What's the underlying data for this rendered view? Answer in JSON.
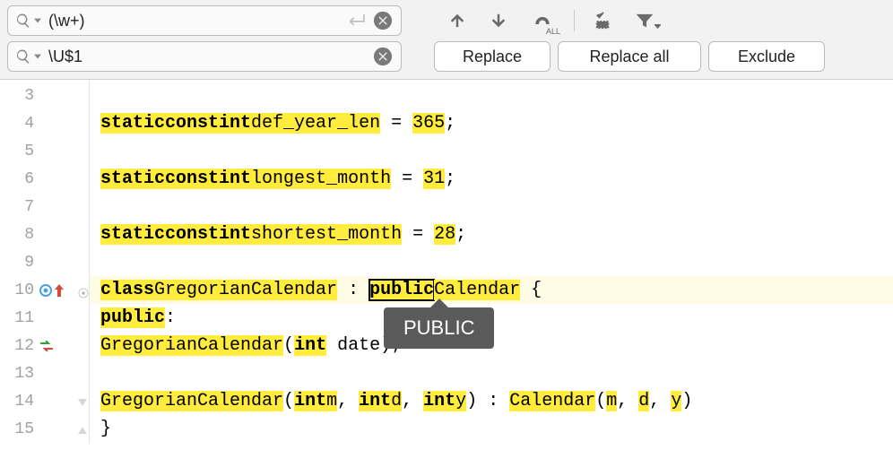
{
  "search": {
    "find_value": "(\\w+)",
    "replace_value": "\\U$1"
  },
  "buttons": {
    "replace": "Replace",
    "replace_all": "Replace all",
    "exclude": "Exclude"
  },
  "tooltip": "PUBLIC",
  "lines": {
    "l3": "3",
    "l4": "4",
    "l5": "5",
    "l6": "6",
    "l7": "7",
    "l8": "8",
    "l9": "9",
    "l10": "10",
    "l11": "11",
    "l12": "12",
    "l13": "13",
    "l14": "14",
    "l15": "15"
  },
  "code": {
    "t_static": "static",
    "t_const": "const",
    "t_int": "int",
    "t_class": "class",
    "t_public": "public",
    "def_year_len": "def_year_len",
    "eq365": " = ",
    "n365": "365",
    "semi": ";",
    "longest_month": "longest_month",
    "n31": "31",
    "shortest_month": "shortest_month",
    "n28": "28",
    "GregorianCalendar": "GregorianCalendar",
    "colon_sp": " : ",
    "Calendar": "Calendar",
    "brace_open": " {",
    "public_colon": ":",
    "lparen": "(",
    "date": " date",
    "m": "m",
    "d": "d",
    "y": "y",
    "comma": ", ",
    "rparen_sp": ") ",
    "colon2": ": ",
    "rparen": ")",
    "brace_close": "}"
  }
}
